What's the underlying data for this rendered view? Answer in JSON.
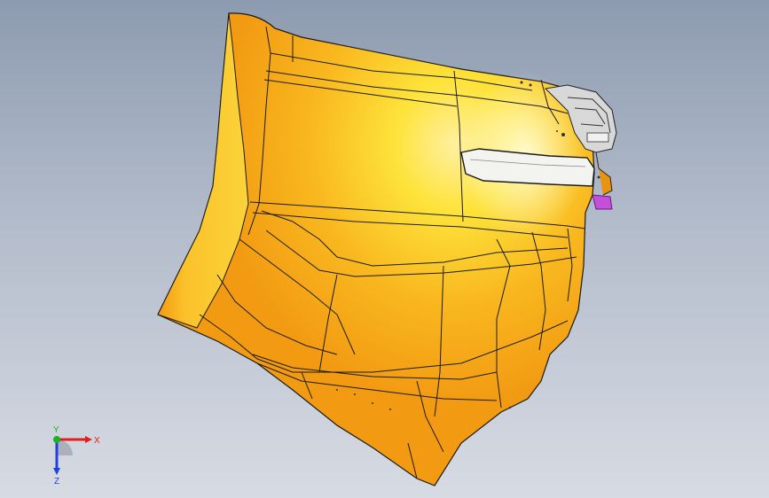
{
  "viewport": {
    "background_top": "#8d9bb0",
    "background_bottom": "#d7dbe3"
  },
  "model": {
    "part_color": "#f7a51e",
    "highlight_color": "#fff04a",
    "edge_color": "#1a1a1a",
    "accent_color": "#c44fd8"
  },
  "triad": {
    "x_label": "X",
    "y_label": "Y",
    "z_label": "Z",
    "x_color": "#e02020",
    "y_color": "#20b020",
    "z_color": "#2040e0"
  }
}
